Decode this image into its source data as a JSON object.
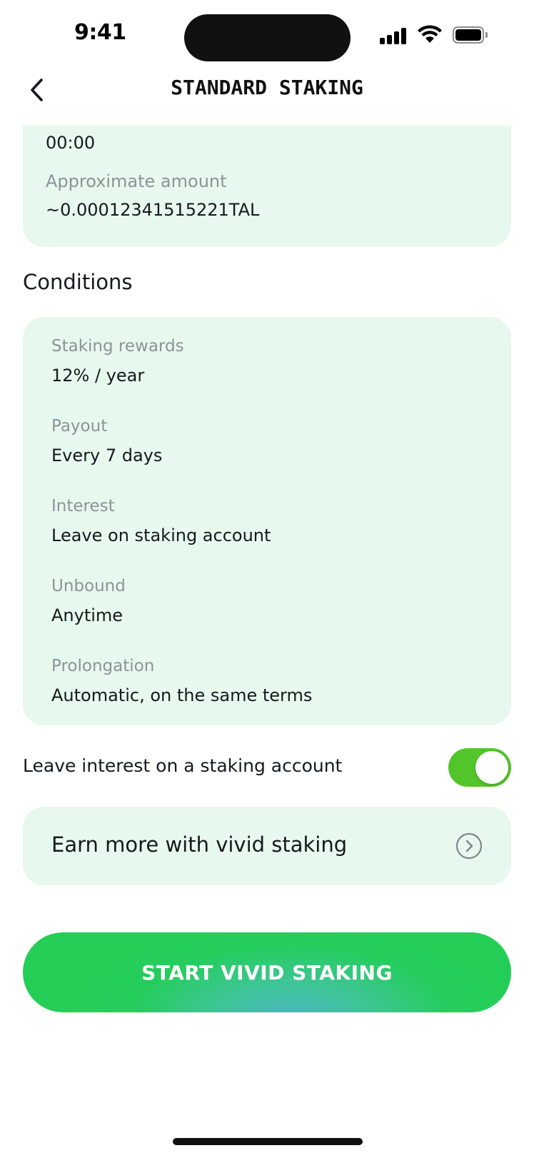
{
  "status_bar": {
    "time": "9:41"
  },
  "header": {
    "title": "STANDARD STAKING",
    "back_icon": "chevron-left-icon"
  },
  "top_card": {
    "time_value": "00:00",
    "approx_label": "Approximate amount",
    "approx_value": "~0.00012341515221TAL"
  },
  "conditions": {
    "title": "Conditions",
    "items": [
      {
        "label": "Staking rewards",
        "value": "12% / year"
      },
      {
        "label": "Payout",
        "value": "Every 7 days"
      },
      {
        "label": "Interest",
        "value": "Leave on staking account"
      },
      {
        "label": "Unbound",
        "value": "Anytime"
      },
      {
        "label": "Prolongation",
        "value": "Automatic, on the same terms"
      }
    ]
  },
  "toggle": {
    "label": "Leave interest on a staking account",
    "on": true,
    "color": "#52c52a"
  },
  "earn_more": {
    "label": "Earn more with vivid staking",
    "icon": "chevron-right-circle-icon"
  },
  "primary_button": {
    "label": "START VIVID STAKING"
  },
  "colors": {
    "card_bg": "#e7f8ee",
    "accent": "#24ce56",
    "muted_text": "#8c939a"
  }
}
